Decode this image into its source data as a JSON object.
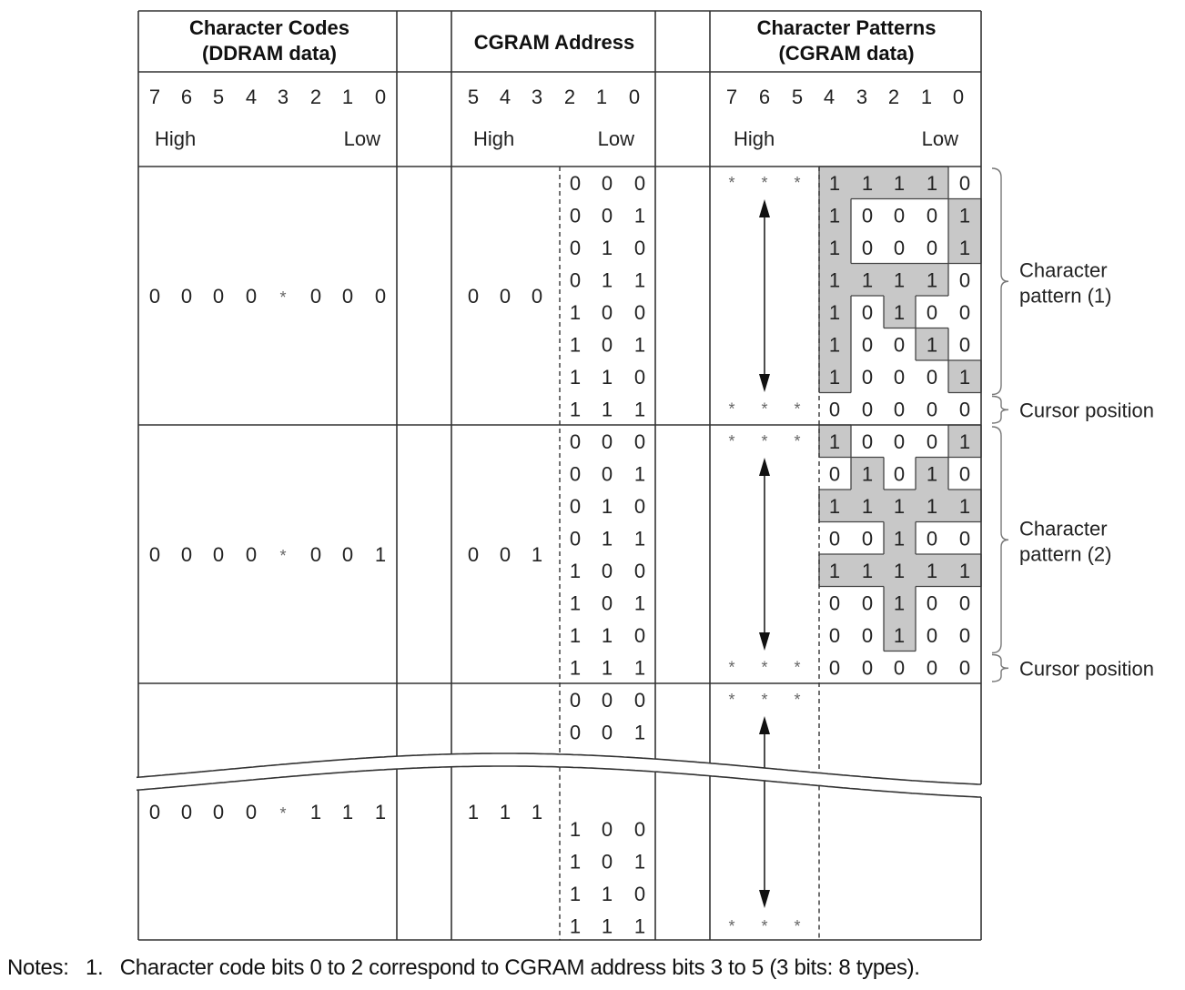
{
  "headers": {
    "char_codes_line1": "Character Codes",
    "char_codes_line2": "(DDRAM data)",
    "cgram_address": "CGRAM Address",
    "char_patterns_line1": "Character Patterns",
    "char_patterns_line2": "(CGRAM data)"
  },
  "bit_labels": {
    "char_codes": [
      "7",
      "6",
      "5",
      "4",
      "3",
      "2",
      "1",
      "0"
    ],
    "cgram_address": [
      "5",
      "4",
      "3",
      "2",
      "1",
      "0"
    ],
    "char_patterns": [
      "7",
      "6",
      "5",
      "4",
      "3",
      "2",
      "1",
      "0"
    ],
    "high": "High",
    "low": "Low"
  },
  "blocks": [
    {
      "char_code": [
        "0",
        "0",
        "0",
        "0",
        "*",
        "0",
        "0",
        "0"
      ],
      "cgram_high": [
        "0",
        "0",
        "0"
      ],
      "cgram_low": [
        [
          "0",
          "0",
          "0"
        ],
        [
          "0",
          "0",
          "1"
        ],
        [
          "0",
          "1",
          "0"
        ],
        [
          "0",
          "1",
          "1"
        ],
        [
          "1",
          "0",
          "0"
        ],
        [
          "1",
          "0",
          "1"
        ],
        [
          "1",
          "1",
          "0"
        ],
        [
          "1",
          "1",
          "1"
        ]
      ],
      "pattern_rows": [
        [
          "1",
          "1",
          "1",
          "1",
          "0"
        ],
        [
          "1",
          "0",
          "0",
          "0",
          "1"
        ],
        [
          "1",
          "0",
          "0",
          "0",
          "1"
        ],
        [
          "1",
          "1",
          "1",
          "1",
          "0"
        ],
        [
          "1",
          "0",
          "1",
          "0",
          "0"
        ],
        [
          "1",
          "0",
          "0",
          "1",
          "0"
        ],
        [
          "1",
          "0",
          "0",
          "0",
          "1"
        ],
        [
          "0",
          "0",
          "0",
          "0",
          "0"
        ]
      ],
      "pattern_label": [
        "Character",
        "pattern (1)"
      ],
      "cursor_label": "Cursor position"
    },
    {
      "char_code": [
        "0",
        "0",
        "0",
        "0",
        "*",
        "0",
        "0",
        "1"
      ],
      "cgram_high": [
        "0",
        "0",
        "1"
      ],
      "cgram_low": [
        [
          "0",
          "0",
          "0"
        ],
        [
          "0",
          "0",
          "1"
        ],
        [
          "0",
          "1",
          "0"
        ],
        [
          "0",
          "1",
          "1"
        ],
        [
          "1",
          "0",
          "0"
        ],
        [
          "1",
          "0",
          "1"
        ],
        [
          "1",
          "1",
          "0"
        ],
        [
          "1",
          "1",
          "1"
        ]
      ],
      "pattern_rows": [
        [
          "1",
          "0",
          "0",
          "0",
          "1"
        ],
        [
          "0",
          "1",
          "0",
          "1",
          "0"
        ],
        [
          "1",
          "1",
          "1",
          "1",
          "1"
        ],
        [
          "0",
          "0",
          "1",
          "0",
          "0"
        ],
        [
          "1",
          "1",
          "1",
          "1",
          "1"
        ],
        [
          "0",
          "0",
          "1",
          "0",
          "0"
        ],
        [
          "0",
          "0",
          "1",
          "0",
          "0"
        ],
        [
          "0",
          "0",
          "0",
          "0",
          "0"
        ]
      ],
      "pattern_label": [
        "Character",
        "pattern (2)"
      ],
      "cursor_label": "Cursor position"
    },
    {
      "char_code": [
        "0",
        "0",
        "0",
        "0",
        "*",
        "1",
        "1",
        "1"
      ],
      "cgram_high": [
        "1",
        "1",
        "1"
      ],
      "cgram_low_top": [
        [
          "0",
          "0",
          "0"
        ],
        [
          "0",
          "0",
          "1"
        ]
      ],
      "cgram_low_bottom": [
        [
          "1",
          "0",
          "0"
        ],
        [
          "1",
          "0",
          "1"
        ],
        [
          "1",
          "1",
          "0"
        ],
        [
          "1",
          "1",
          "1"
        ]
      ]
    }
  ],
  "dont_care": "*",
  "fill_color": "#c8c8c8",
  "notes": {
    "prefix": "Notes:",
    "number": "1.",
    "text": "Character code bits 0 to 2 correspond to CGRAM address bits 3 to 5 (3 bits: 8 types)."
  }
}
